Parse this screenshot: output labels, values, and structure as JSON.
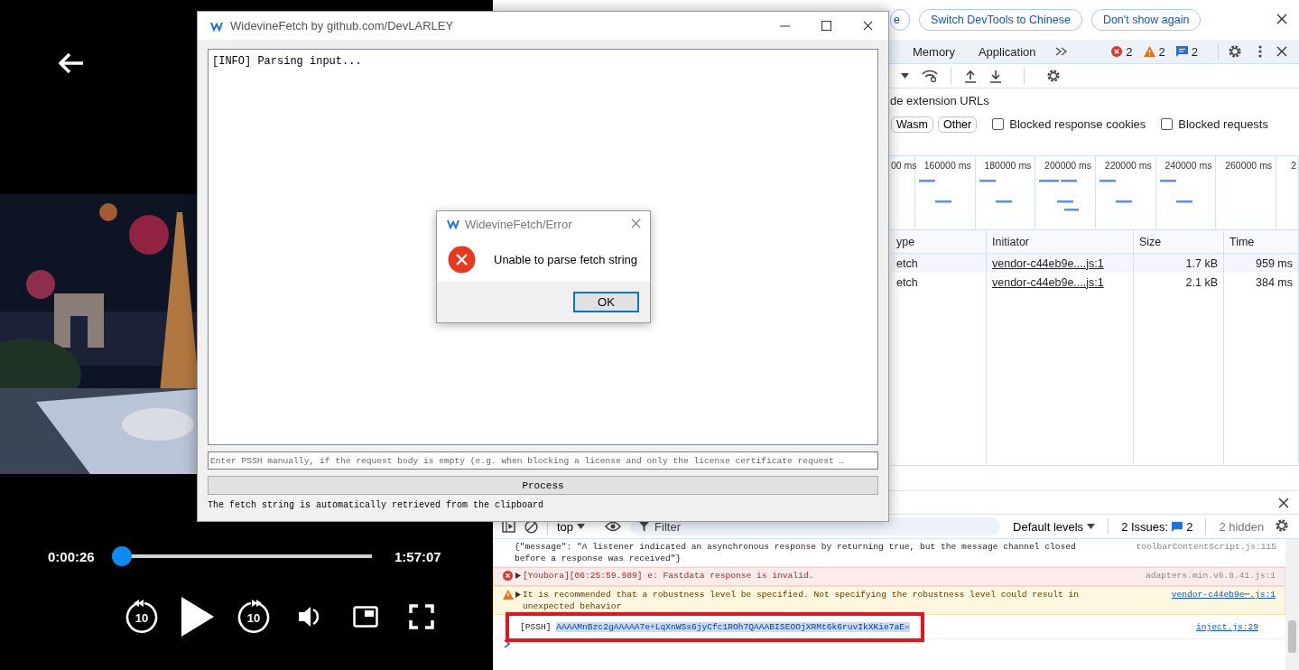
{
  "video_player": {
    "elapsed": "0:00:26",
    "progress": {
      "level": 0.004
    },
    "duration": "1:57:07",
    "rewind_label": "10",
    "forward_label": "10"
  },
  "devtools": {
    "banner_buttons": [
      {
        "label": "e"
      },
      {
        "label": "Switch DevTools to Chinese"
      },
      {
        "label": "Don't show again"
      }
    ],
    "tabs": [
      {
        "label": "Memory",
        "selected": false
      },
      {
        "label": "Application",
        "selected": false
      }
    ],
    "counts": {
      "errors": "2",
      "warnings": "2",
      "info": "2"
    },
    "filter_text": "de extension URLs",
    "type_filters": [
      {
        "label": "Wasm"
      },
      {
        "label": "Other"
      }
    ],
    "checkboxes": [
      {
        "label": "Blocked response cookies",
        "checked": false
      },
      {
        "label": "Blocked requests",
        "checked": false
      }
    ],
    "timeline_ticks": [
      "00 ms",
      "160000 ms",
      "180000 ms",
      "200000 ms",
      "220000 ms",
      "240000 ms",
      "260000 ms",
      "2"
    ],
    "table": {
      "columns": [
        "ype",
        "Initiator",
        "Size",
        "Time"
      ],
      "rows": [
        {
          "column_1": "etch",
          "initiator": "vendor-c44eb9e....js:1",
          "size": "1.7 kB",
          "time": "959 ms"
        },
        {
          "column_1": "etch",
          "initiator": "vendor-c44eb9e....js:1",
          "size": "2.1 kB",
          "time": "384 ms"
        }
      ]
    },
    "console": {
      "context": "top",
      "filter_placeholder": "Filter",
      "levels": "Default levels",
      "issues_label": "2 Issues:",
      "issues_count": "2",
      "hidden": "2 hidden",
      "messages": [
        {
          "kind": "log",
          "text": "{\"message\": \"A listener indicated an asynchronous response by returning true, but the message channel closed before a response was received\"}",
          "source": "toolbarContentScript.js:115",
          "source_link": false,
          "expandable": false
        },
        {
          "kind": "error",
          "text": "[Youbora][06:25:59.989] e: Fastdata response is invalid.",
          "source": "adapters.min.v6.8.41.js:1",
          "source_link": false,
          "expandable": true
        },
        {
          "kind": "warning",
          "text": "It is recommended that a robustness level be specified. Not specifying the robustness level could result in unexpected behavior",
          "source": "vendor-c44eb9e⋯.js:1",
          "source_link": true,
          "expandable": true
        },
        {
          "kind": "log",
          "text": "[PSSH] ",
          "selection": "AAAAMnBzc2gAAAAA7e+LqXnWSs6jyCfc1ROh7QAAABISEOOjXRMt6k6ruvIkXKie7aE=",
          "source": "inject.js:29",
          "source_link": true,
          "expandable": false,
          "annotated": true
        }
      ]
    }
  },
  "app_window": {
    "title": "WidevineFetch by github.com/DevLARLEY",
    "log": "[INFO] Parsing input...",
    "pssh_placeholder": "Enter PSSH manually, if the request body is empty (e.g. when blocking a license and only the license certificate request …",
    "process_button": "Process",
    "status": "The fetch string is automatically retrieved from the clipboard"
  },
  "error_dialog": {
    "title": "WidevineFetch/Error",
    "message": "Unable to parse fetch string",
    "ok_button": "OK"
  }
}
